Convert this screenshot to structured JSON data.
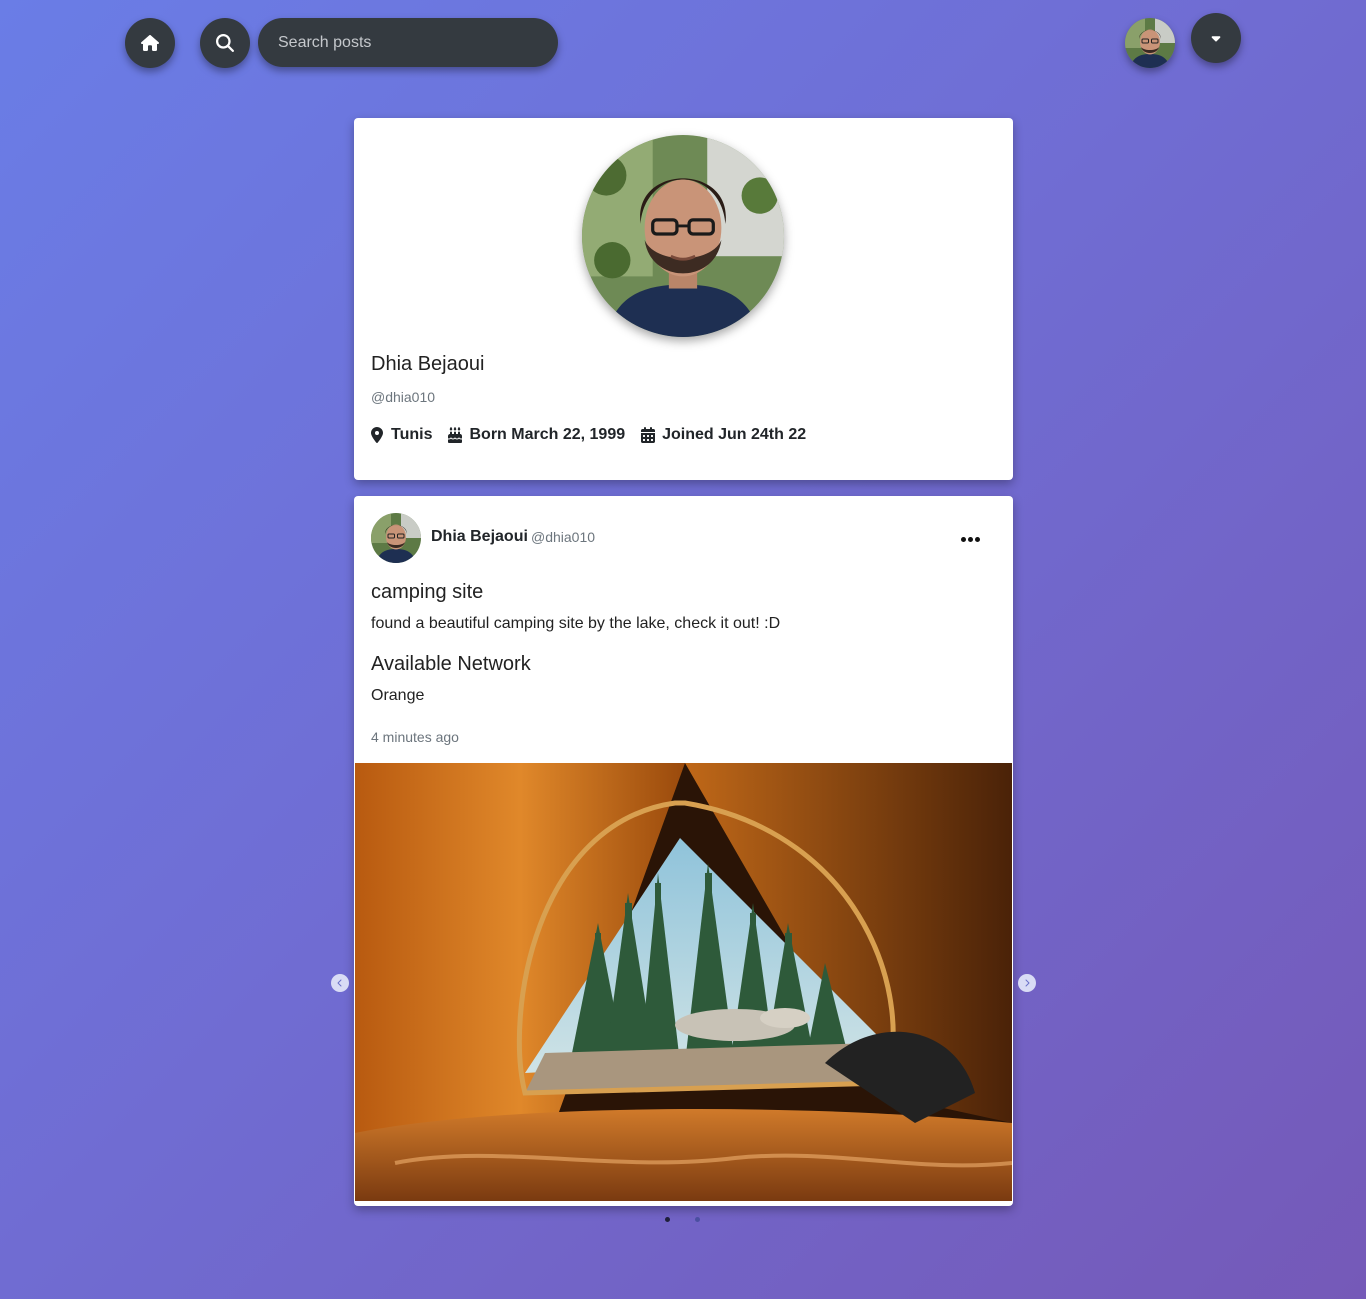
{
  "topbar": {
    "home_icon": "home-icon",
    "search_icon": "search-icon",
    "search_placeholder": "Search posts",
    "dropdown_icon": "caret-down-icon"
  },
  "profile": {
    "name": "Dhia Bejaoui",
    "handle": "@dhia010",
    "location": "Tunis",
    "born": "Born March 22, 1999",
    "joined": "Joined Jun 24th 22"
  },
  "post": {
    "author": "Dhia Bejaoui",
    "handle": "@dhia010",
    "title": "camping site",
    "body": "found a beautiful camping site by the lake, check it out! :D",
    "network_heading": "Available Network",
    "network_value": "Orange",
    "time": "4 minutes ago",
    "image_count": 2,
    "active_image": 1
  },
  "colors": {
    "background_start": "#6a7de6",
    "background_end": "#7559b8",
    "button_dark": "#343a40",
    "card": "#ffffff"
  }
}
